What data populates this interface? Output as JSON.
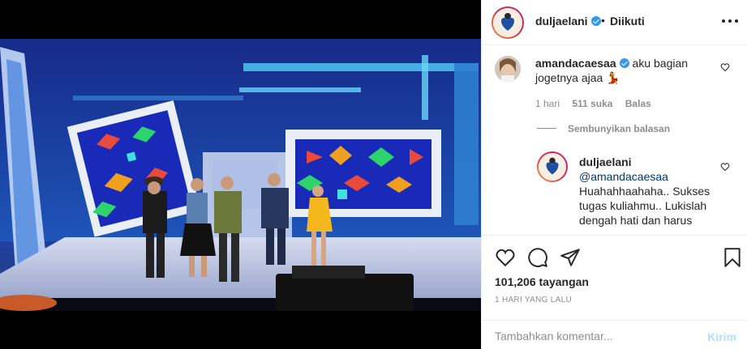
{
  "header": {
    "username": "duljaelani",
    "verified_icon": "verified-badge-icon",
    "dot": "•",
    "follow_status": "Diikuti",
    "more_icon": "more-options-icon"
  },
  "comments": [
    {
      "username": "amandacaesaa",
      "verified": true,
      "text": "aku bagian jogetnya ajaa 💃",
      "time": "1 hari",
      "likes": "511 suka",
      "reply_label": "Balas",
      "hide_replies_label": "Sembunyikan balasan",
      "replies": [
        {
          "username": "duljaelani",
          "mention": "@amandacaesaa",
          "text": "Huahahhaahaha.. Sukses tugas kuliahmu.. Lukislah dengah hati dan harus"
        }
      ]
    }
  ],
  "actions": {
    "like_icon": "heart-icon",
    "comment_icon": "comment-icon",
    "share_icon": "share-icon",
    "save_icon": "bookmark-icon",
    "views": "101,206 tayangan",
    "date": "1 HARI YANG LALU"
  },
  "comment_box": {
    "placeholder": "Tambahkan komentar...",
    "post_label": "Kirim"
  },
  "colors": {
    "link": "#00376b",
    "post_disabled": "#b2dffc",
    "verified": "#3897f0",
    "secondary_text": "#8e8e8e",
    "dress_yellow": "#f5b81c"
  }
}
